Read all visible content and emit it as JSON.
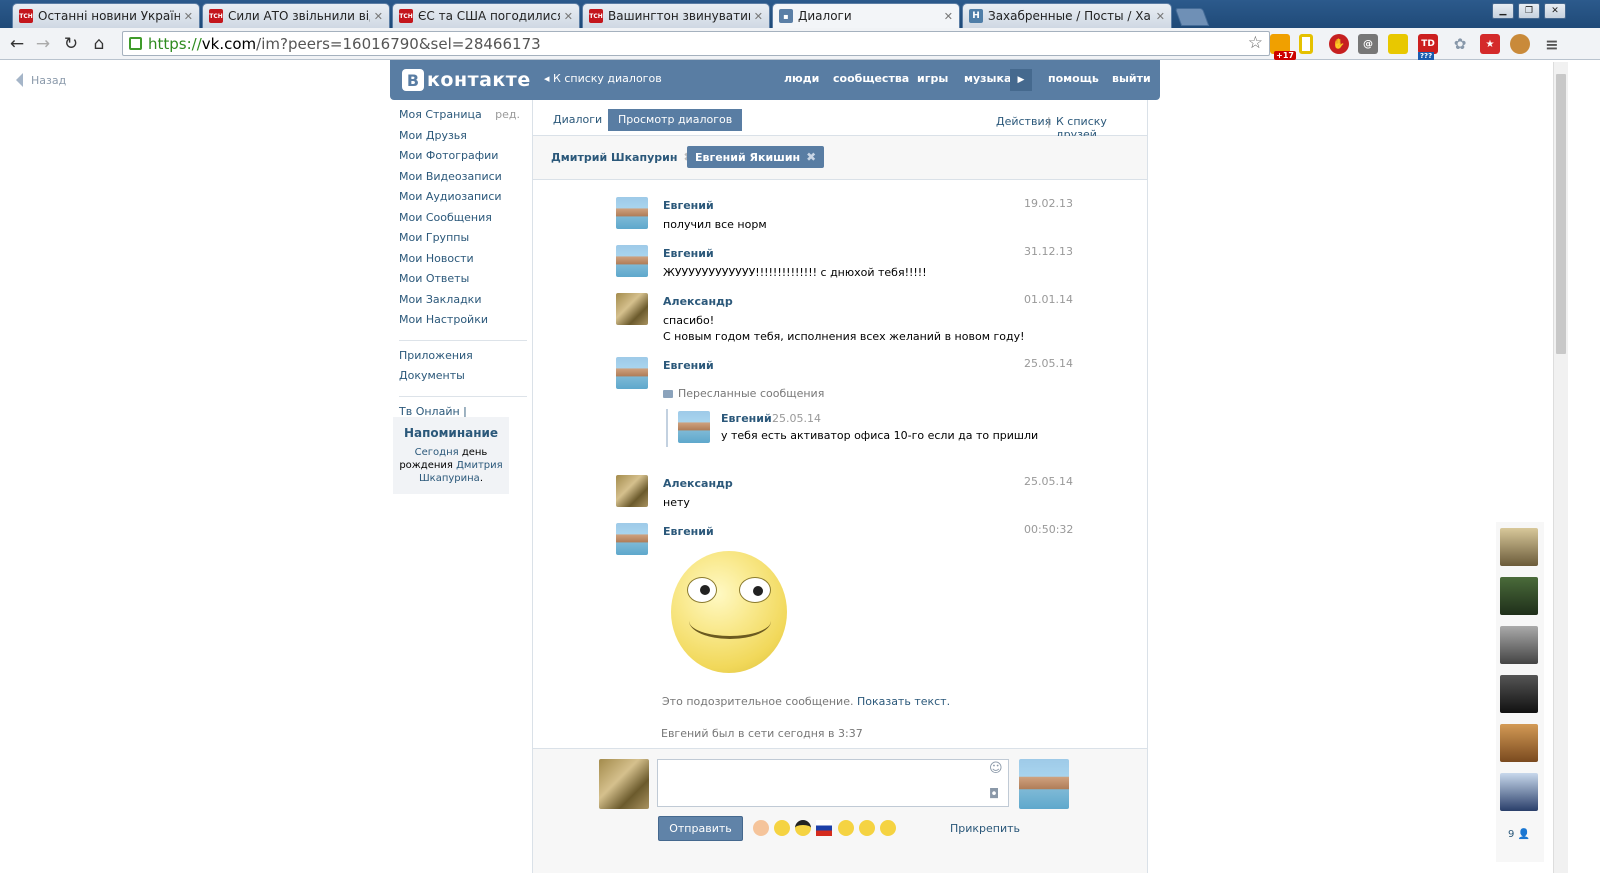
{
  "browser": {
    "tabs": [
      {
        "title": "Останні новини України.",
        "icon": "tsn-icon",
        "active": false
      },
      {
        "title": "Сили АТО звільнили від т",
        "icon": "tsn-icon",
        "active": false
      },
      {
        "title": "ЄС та США погодилися п",
        "icon": "tsn-icon",
        "active": false
      },
      {
        "title": "Вашингтон звинуватив Р",
        "icon": "tsn-icon",
        "active": false
      },
      {
        "title": "Диалоги",
        "icon": "vk-icon",
        "active": true
      },
      {
        "title": "Захабренные / Посты / Ха",
        "icon": "habr-icon",
        "active": false
      }
    ],
    "tab_icon_label": "ТСН",
    "url_https": "https://",
    "url_host": "vk.com",
    "url_path": "/im?peers=16016790&sel=28466173",
    "ext_badge": "+17",
    "ext_td": "TD",
    "ext_q": "???"
  },
  "back_link": "Назад",
  "header": {
    "logo": "контакте",
    "logo_letter": "В",
    "back": "К списку диалогов",
    "nav": [
      "люди",
      "сообщества",
      "игры",
      "музыка",
      "помощь",
      "выйти"
    ]
  },
  "sidebar": {
    "items": [
      "Моя Страница",
      "Мои Друзья",
      "Мои Фотографии",
      "Мои Видеозаписи",
      "Мои Аудиозаписи",
      "Мои Сообщения",
      "Мои Группы",
      "Мои Новости",
      "Мои Ответы",
      "Мои Закладки",
      "Мои Настройки"
    ],
    "edit": "ред.",
    "extra": [
      "Приложения",
      "Документы"
    ],
    "tv": "Тв Онлайн |"
  },
  "reminder": {
    "title": "Напоминание",
    "today": "Сегодня",
    "text1": "день рождения",
    "name": "Дмитрия Шкапурина",
    "end": "."
  },
  "tabs": {
    "dialogs": "Диалоги",
    "view": "Просмотр диалогов",
    "actions": "Действия",
    "sep": "|",
    "friends": "К списку друзей"
  },
  "peers": [
    {
      "name": "Дмитрий Шкапурин"
    },
    {
      "name": "Евгений Якишин"
    }
  ],
  "messages": [
    {
      "author": "Евгений",
      "date": "19.02.13",
      "lines": [
        "получил все норм"
      ]
    },
    {
      "author": "Евгений",
      "date": "31.12.13",
      "lines": [
        "ЖУУУУУУУУУУУУ!!!!!!!!!!!!!! с днюхой тебя!!!!!"
      ]
    },
    {
      "author": "Александр",
      "date": "01.01.14",
      "lines": [
        "спасибо!",
        "С новым годом тебя, исполнения всех желаний в новом году!"
      ]
    },
    {
      "author": "Евгений",
      "date": "25.05.14",
      "forwarded_label": "Пересланные сообщения",
      "forwarded": {
        "author": "Евгений",
        "date": "25.05.14",
        "text": "у тебя есть активатор офиса 10-го если да то пришли"
      }
    },
    {
      "author": "Александр",
      "date": "25.05.14",
      "lines": [
        "нету"
      ]
    },
    {
      "author": "Евгений",
      "date": "00:50:32",
      "sticker": "smiley"
    }
  ],
  "suspicious": "Это подозрительное сообщение.",
  "show_text": "Показать текст.",
  "online_status": "Евгений был в сети сегодня в 3:37",
  "compose": {
    "send": "Отправить",
    "attach": "Прикрепить",
    "placeholder": ""
  },
  "friends_count": "9"
}
